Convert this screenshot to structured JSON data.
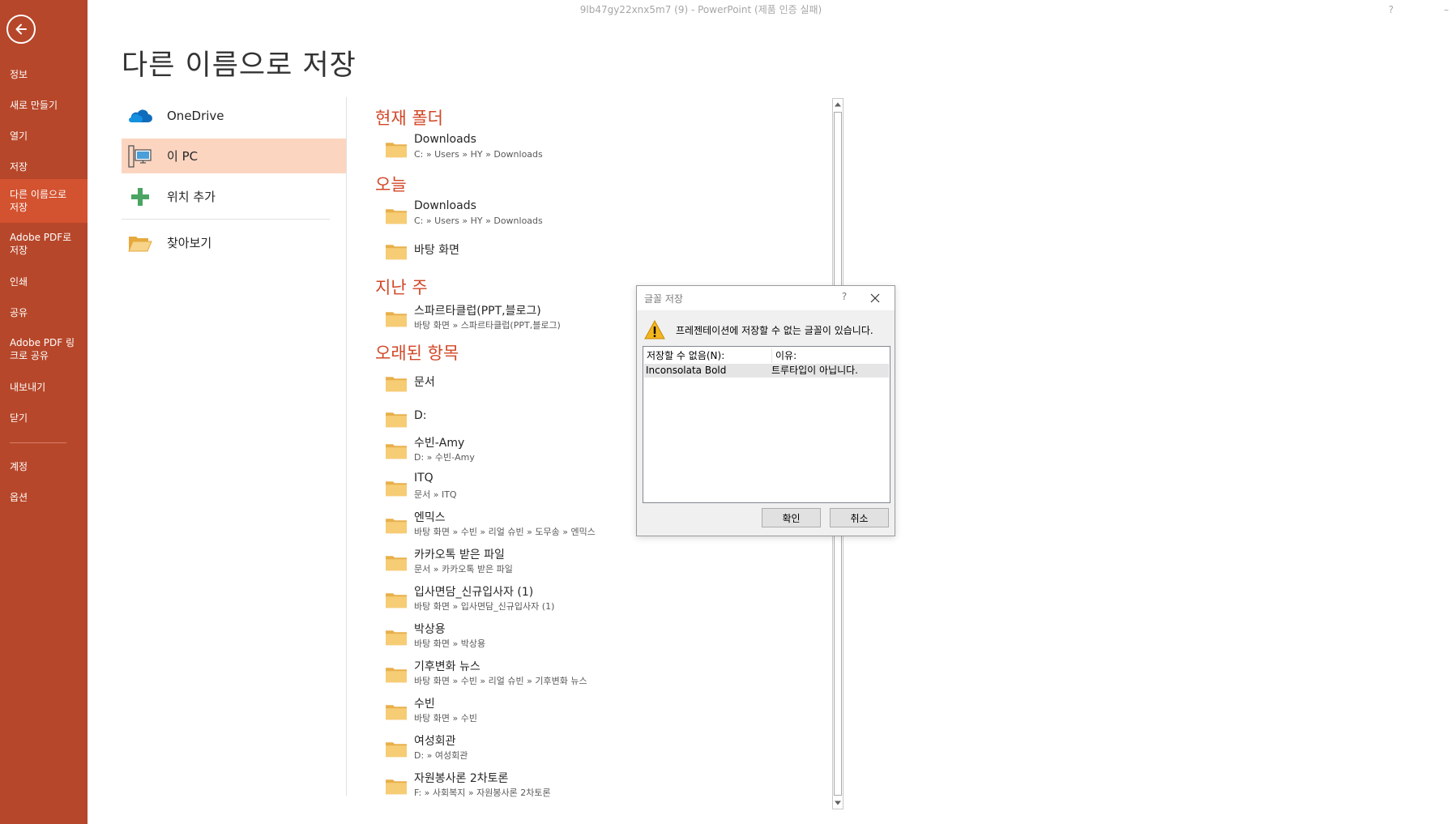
{
  "window": {
    "title": "9lb47gy22xnx5m7 (9)  -  PowerPoint (제품 인증 실패)",
    "help_glyph": "?",
    "min_glyph": "–"
  },
  "rail": {
    "items": [
      {
        "id": "info",
        "label": "정보"
      },
      {
        "id": "new",
        "label": "새로 만들기"
      },
      {
        "id": "open",
        "label": "열기"
      },
      {
        "id": "save",
        "label": "저장"
      },
      {
        "id": "saveas",
        "label": "다른 이름으로 저장"
      },
      {
        "id": "adobepdf",
        "label": "Adobe PDF로 저장"
      },
      {
        "id": "print",
        "label": "인쇄"
      },
      {
        "id": "share",
        "label": "공유"
      },
      {
        "id": "adobepdflink",
        "label": "Adobe PDF 링크로 공유"
      },
      {
        "id": "export",
        "label": "내보내기"
      },
      {
        "id": "close",
        "label": "닫기"
      },
      {
        "id": "account",
        "label": "계정"
      },
      {
        "id": "options",
        "label": "옵션"
      }
    ]
  },
  "page_title": "다른 이름으로 저장",
  "locations": [
    {
      "id": "onedrive",
      "label": "OneDrive",
      "icon": "cloud-icon"
    },
    {
      "id": "thispc",
      "label": "이 PC",
      "icon": "computer-icon"
    },
    {
      "id": "addplace",
      "label": "위치 추가",
      "icon": "plus-icon"
    },
    {
      "id": "browse",
      "label": "찾아보기",
      "icon": "open-folder-icon"
    }
  ],
  "groups": [
    {
      "heading": "현재 폴더",
      "items": [
        {
          "name": "Downloads",
          "path": "C: » Users » HY » Downloads"
        }
      ]
    },
    {
      "heading": "오늘",
      "items": [
        {
          "name": "Downloads",
          "path": "C: » Users » HY » Downloads"
        },
        {
          "name": "바탕 화면",
          "path": ""
        }
      ]
    },
    {
      "heading": "지난 주",
      "items": [
        {
          "name": "스파르타클럽(PPT,블로그)",
          "path": "바탕 화면 » 스파르타클럽(PPT,블로그)"
        }
      ]
    },
    {
      "heading": "오래된 항목",
      "items": [
        {
          "name": "문서",
          "path": ""
        },
        {
          "name": "D:",
          "path": ""
        },
        {
          "name": "수빈-Amy",
          "path": "D: » 수빈-Amy"
        },
        {
          "name": "ITQ",
          "path": "문서 » ITQ"
        },
        {
          "name": "엔믹스",
          "path": "바탕 화면 » 수빈 » 리얼 슈빈 » 도무송 » 엔믹스"
        },
        {
          "name": "카카오톡 받은 파일",
          "path": "문서 » 카카오톡 받은 파일"
        },
        {
          "name": "입사면담_신규입사자 (1)",
          "path": "바탕 화면 » 입사면담_신규입사자 (1)"
        },
        {
          "name": "박상용",
          "path": "바탕 화면 » 박상용"
        },
        {
          "name": "기후변화 뉴스",
          "path": "바탕 화면 » 수빈 » 리얼 슈빈 » 기후변화 뉴스"
        },
        {
          "name": "수빈",
          "path": "바탕 화면 » 수빈"
        },
        {
          "name": "여성회관",
          "path": "D: » 여성회관"
        },
        {
          "name": "자원봉사론 2차토론",
          "path": "F: » 사회복지 » 자원봉사론 2차토론"
        }
      ]
    }
  ],
  "dialog": {
    "title": "글꼴 저장",
    "help": "?",
    "message": "프레젠테이션에 저장할 수 없는 글꼴이 있습니다.",
    "col1_header": "저장할 수 없음(N):",
    "col2_header": "이유:",
    "rows": [
      {
        "font": "Inconsolata Bold",
        "reason": "트루타입이 아닙니다."
      }
    ],
    "ok_label": "확인",
    "cancel_label": "취소"
  },
  "colors": {
    "rail": "#b7472a",
    "rail_active": "#d35230",
    "heading_accent": "#d24726",
    "location_active": "#fcd5c1",
    "folder": "#f4c86c"
  }
}
